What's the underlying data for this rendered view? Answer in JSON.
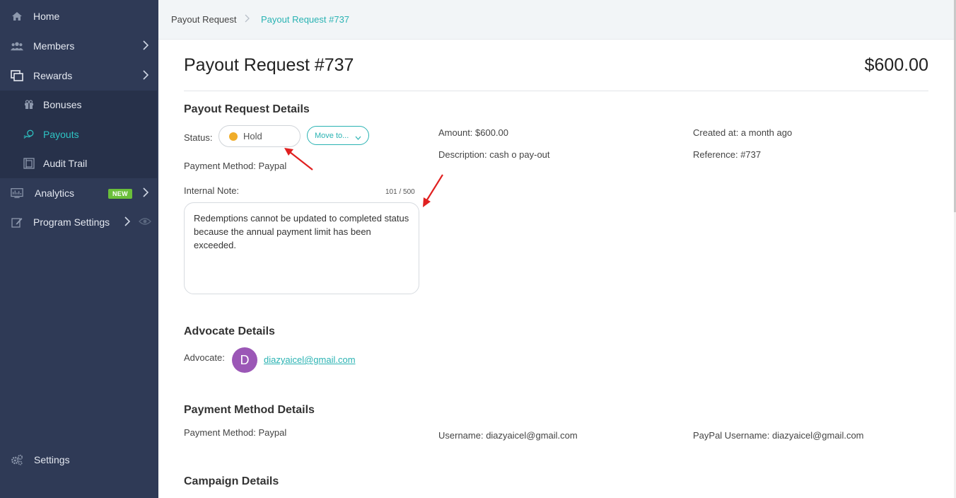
{
  "sidebar": {
    "items": [
      {
        "label": "Home",
        "icon": "home-icon"
      },
      {
        "label": "Members",
        "icon": "members-icon"
      },
      {
        "label": "Rewards",
        "icon": "rewards-icon"
      },
      {
        "label": "Analytics",
        "icon": "analytics-icon",
        "badge": "NEW"
      },
      {
        "label": "Program Settings",
        "icon": "edit-icon"
      },
      {
        "label": "Settings",
        "icon": "gears-icon"
      }
    ],
    "rewards_sub": [
      {
        "label": "Bonuses",
        "icon": "gift-icon"
      },
      {
        "label": "Payouts",
        "icon": "payouts-icon",
        "active": true
      },
      {
        "label": "Audit Trail",
        "icon": "audit-icon"
      }
    ]
  },
  "breadcrumb": {
    "parent": "Payout Request",
    "current": "Payout Request #737"
  },
  "page": {
    "title": "Payout Request #737",
    "amount": "$600.00"
  },
  "details": {
    "section_title": "Payout Request Details",
    "status_label": "Status:",
    "status_value": "Hold",
    "move_label": "Move to...",
    "payment_method": "Payment Method: Paypal",
    "amount": "Amount: $600.00",
    "description": "Description: cash o pay-out",
    "created_at": "Created at: a month ago",
    "reference": "Reference: #737",
    "internal_note_label": "Internal Note:",
    "note_counter": "101 / 500",
    "note_text": "Redemptions cannot be updated to completed status because the annual payment limit has been exceeded."
  },
  "advocate": {
    "section_title": "Advocate Details",
    "label": "Advocate:",
    "initial": "D",
    "email": "diazyaicel@gmail.com"
  },
  "payment_method": {
    "section_title": "Payment Method Details",
    "method": "Payment Method: Paypal",
    "username": "Username: diazyaicel@gmail.com",
    "paypal_username": "PayPal Username: diazyaicel@gmail.com"
  },
  "campaign": {
    "section_title": "Campaign Details"
  },
  "colors": {
    "sidebar_bg": "#2f3a56",
    "accent": "#2ab3b3",
    "hold": "#f0ad2a",
    "avatar": "#9b57b6",
    "annotation_arrow": "#e02020"
  }
}
